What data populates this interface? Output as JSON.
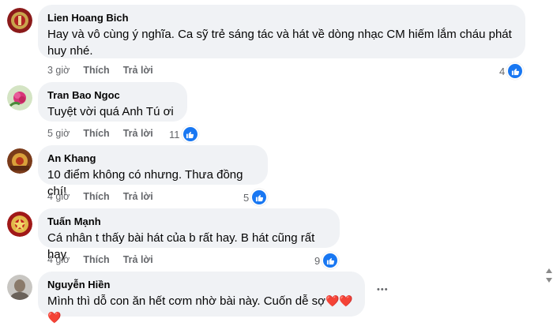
{
  "comments": [
    {
      "author": "Lien Hoang Bich",
      "text_line1": "Hay và vô cùng ý nghĩa. Ca sỹ trẻ sáng tác và hát về dòng nhạc CM hiếm lắm cháu phát",
      "text_line2": "huy nhé.",
      "time": "3 giờ",
      "like": "Thích",
      "reply": "Trả lời",
      "count": "4"
    },
    {
      "author": "Tran Bao Ngoc",
      "text": "Tuyệt vời quá Anh Tú ơi",
      "time": "5 giờ",
      "like": "Thích",
      "reply": "Trả lời",
      "count": "11"
    },
    {
      "author": "An Khang",
      "text": "10 điểm không có nhưng. Thưa đồng chí!",
      "time": "4 giờ",
      "like": "Thích",
      "reply": "Trả lời",
      "count": "5"
    },
    {
      "author": "Tuấn Mạnh",
      "text": "Cá nhân t thấy bài hát của b rất hay. B hát cũng rất hay",
      "time": "4 giờ",
      "like": "Thích",
      "reply": "Trả lời",
      "count": "9"
    },
    {
      "author": "Nguyễn Hiền",
      "text": "Mình thì dỗ con ăn hết cơm nhờ bài này. Cuốn dễ sợ",
      "hearts": "❤️❤️❤️",
      "more": "•••"
    }
  ],
  "colors": {
    "bubble": "#f0f2f5",
    "like_blue": "#1877f2",
    "meta_gray": "#65676b"
  },
  "icons": {
    "like": "thumbs-up-icon",
    "heart": "heart-icon",
    "more": "more-options-icon"
  }
}
